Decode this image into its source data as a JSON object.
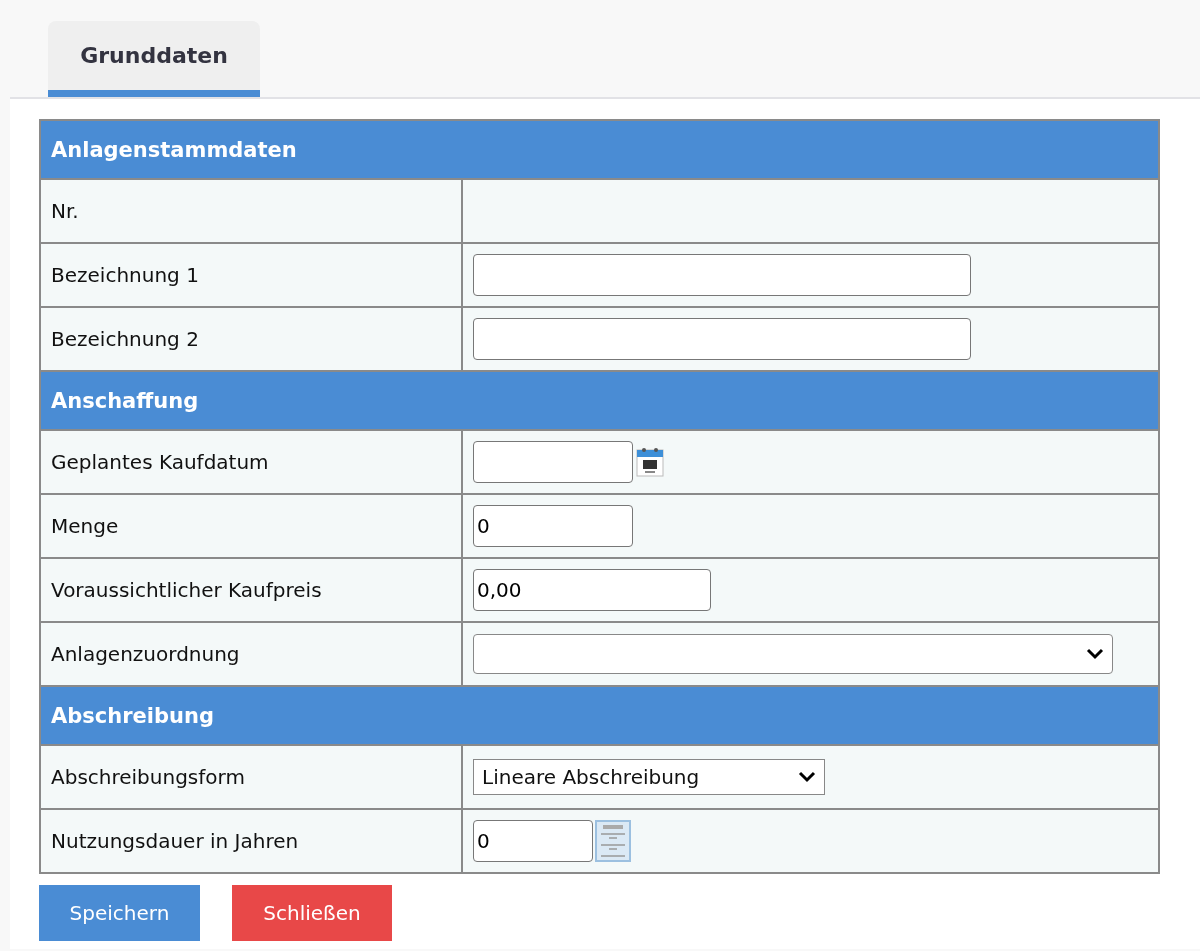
{
  "tabs": [
    {
      "label": "Grunddaten",
      "selected": true
    }
  ],
  "sections": [
    {
      "title": "Anlagenstammdaten",
      "rows": [
        {
          "label": "Nr.",
          "kind": "none"
        },
        {
          "label": "Bezeichnung 1",
          "kind": "text"
        },
        {
          "label": "Bezeichnung 2",
          "kind": "text"
        }
      ]
    },
    {
      "title": "Anschaffung",
      "rows": [
        {
          "label": "Geplantes Kaufdatum",
          "kind": "date"
        },
        {
          "label": "Menge",
          "kind": "number",
          "value": "0"
        },
        {
          "label": "Voraussichtlicher Kaufpreis",
          "kind": "amount",
          "value": "0,00"
        },
        {
          "label": "Anlagenzuordnung",
          "kind": "select"
        }
      ]
    },
    {
      "title": "Abschreibung",
      "rows": [
        {
          "label": "Abschreibungsform",
          "kind": "dropdown",
          "value": "Lineare Abschreibung"
        },
        {
          "label": "Nutzungsdauer in Jahren",
          "kind": "duration",
          "value": "0"
        }
      ]
    }
  ],
  "buttons": [
    {
      "label": "Speichern",
      "kind": "primary"
    },
    {
      "label": "Schließen",
      "kind": "danger"
    }
  ]
}
